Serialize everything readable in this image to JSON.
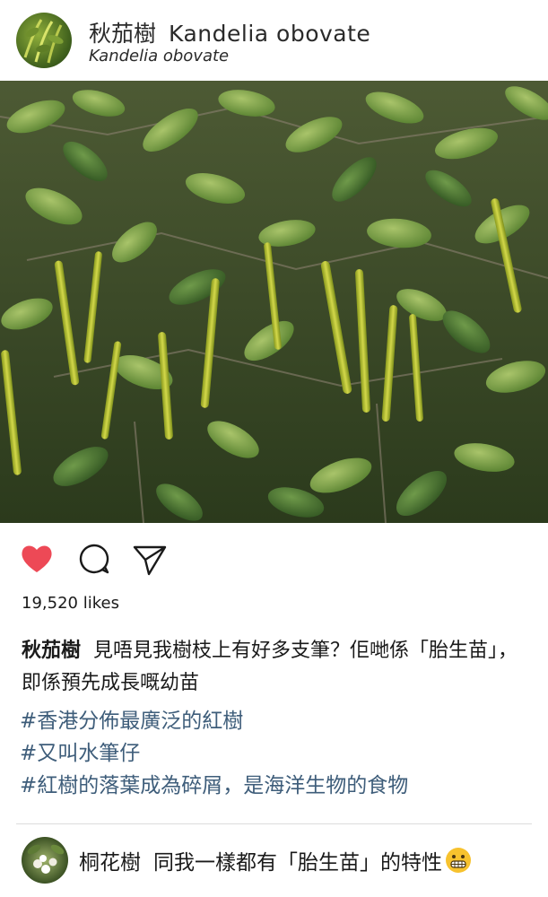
{
  "header": {
    "name_zh": "秋茄樹",
    "name_latin": "Kandelia obovate",
    "subtitle": "Kandelia obovate"
  },
  "post": {
    "likes": "19,520 likes",
    "caption_user": "秋茄樹",
    "caption_text": "見唔見我樹枝上有好多支筆？佢哋係「胎生苗」，即係預先成長嘅幼苗",
    "hashtags": [
      "#香港分佈最廣泛的紅樹",
      "#又叫水筆仔",
      "#紅樹的落葉成為碎屑，是海洋生物的食物"
    ]
  },
  "comment": {
    "user": "桐花樹",
    "text": "同我一樣都有「胎生苗」的特性"
  },
  "icons": {
    "like": "heart-icon",
    "comment": "comment-icon",
    "share": "send-icon",
    "emoji": "grimacing-face-emoji"
  },
  "colors": {
    "heart": "#ed4956",
    "hashtag": "#3e5d7a",
    "text": "#1a1a1a"
  }
}
